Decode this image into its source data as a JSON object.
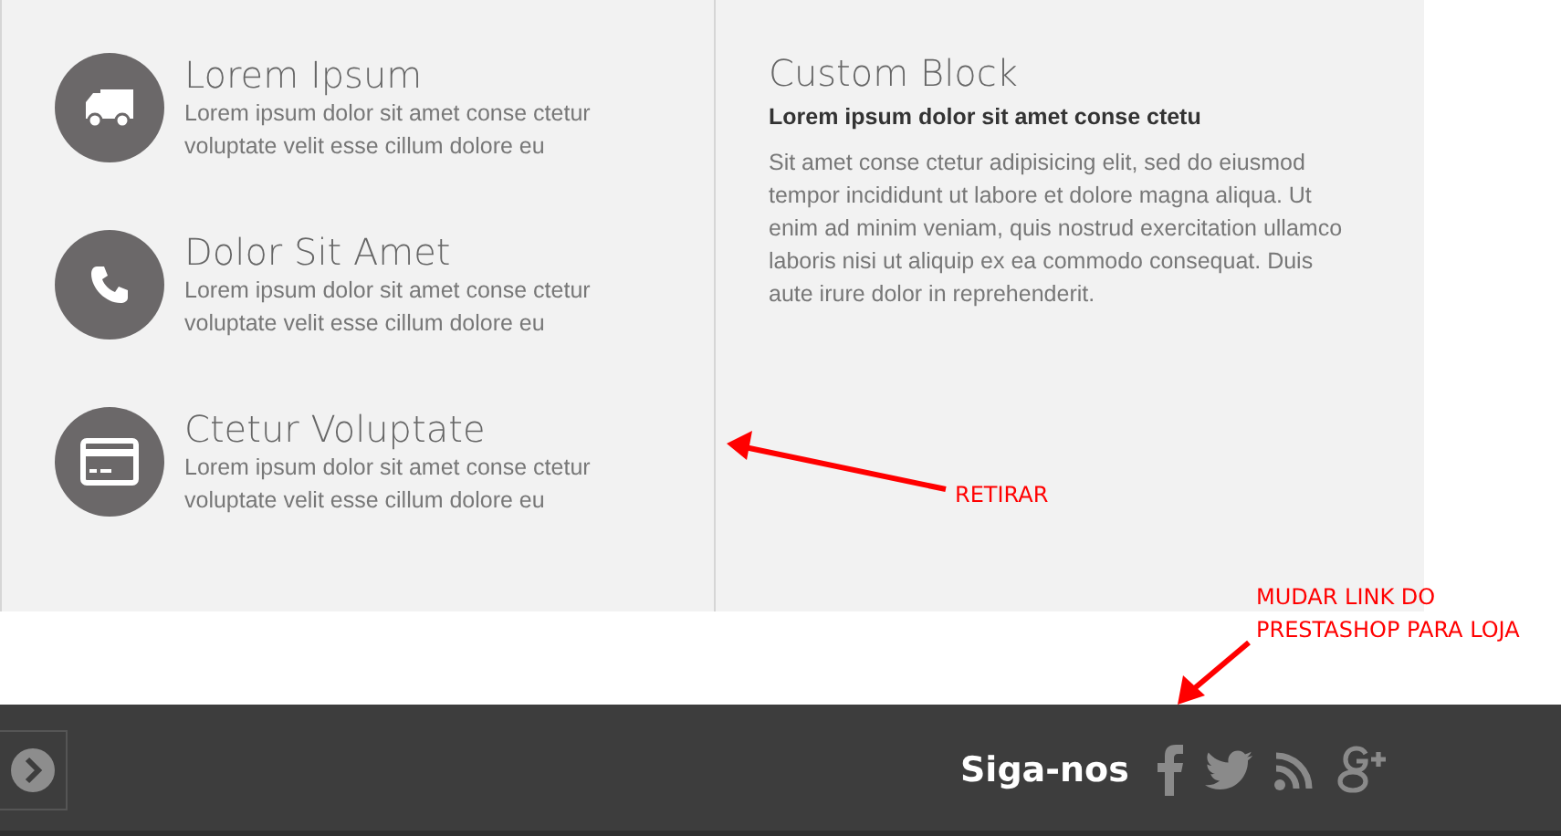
{
  "features": [
    {
      "kind": "truck",
      "title": "Lorem Ipsum",
      "text": "Lorem ipsum dolor sit amet conse ctetur voluptate velit esse cillum dolore eu"
    },
    {
      "kind": "phone",
      "title": "Dolor Sit Amet",
      "text": "Lorem ipsum dolor sit amet conse ctetur voluptate velit esse cillum dolore eu"
    },
    {
      "kind": "card",
      "title": "Ctetur Voluptate",
      "text": "Lorem ipsum dolor sit amet conse ctetur voluptate velit esse cillum dolore eu"
    }
  ],
  "custom_block": {
    "title": "Custom Block",
    "subtitle": "Lorem ipsum dolor sit amet conse ctetu",
    "text": "Sit amet conse ctetur adipisicing elit, sed do eiusmod tempor incididunt ut labore et dolore magna aliqua. Ut enim ad minim veniam, quis nostrud exercitation ullamco laboris nisi ut aliquip ex ea commodo consequat. Duis aute irure dolor in reprehenderit."
  },
  "footer": {
    "follow_label": "Siga-nos",
    "social": [
      {
        "kind": "facebook"
      },
      {
        "kind": "twitter"
      },
      {
        "kind": "rss"
      },
      {
        "kind": "googleplus"
      }
    ]
  },
  "annotations": [
    {
      "text": "RETIRAR"
    },
    {
      "text": "MUDAR LINK DO PRESTASHOP PARA LOJA"
    }
  ]
}
